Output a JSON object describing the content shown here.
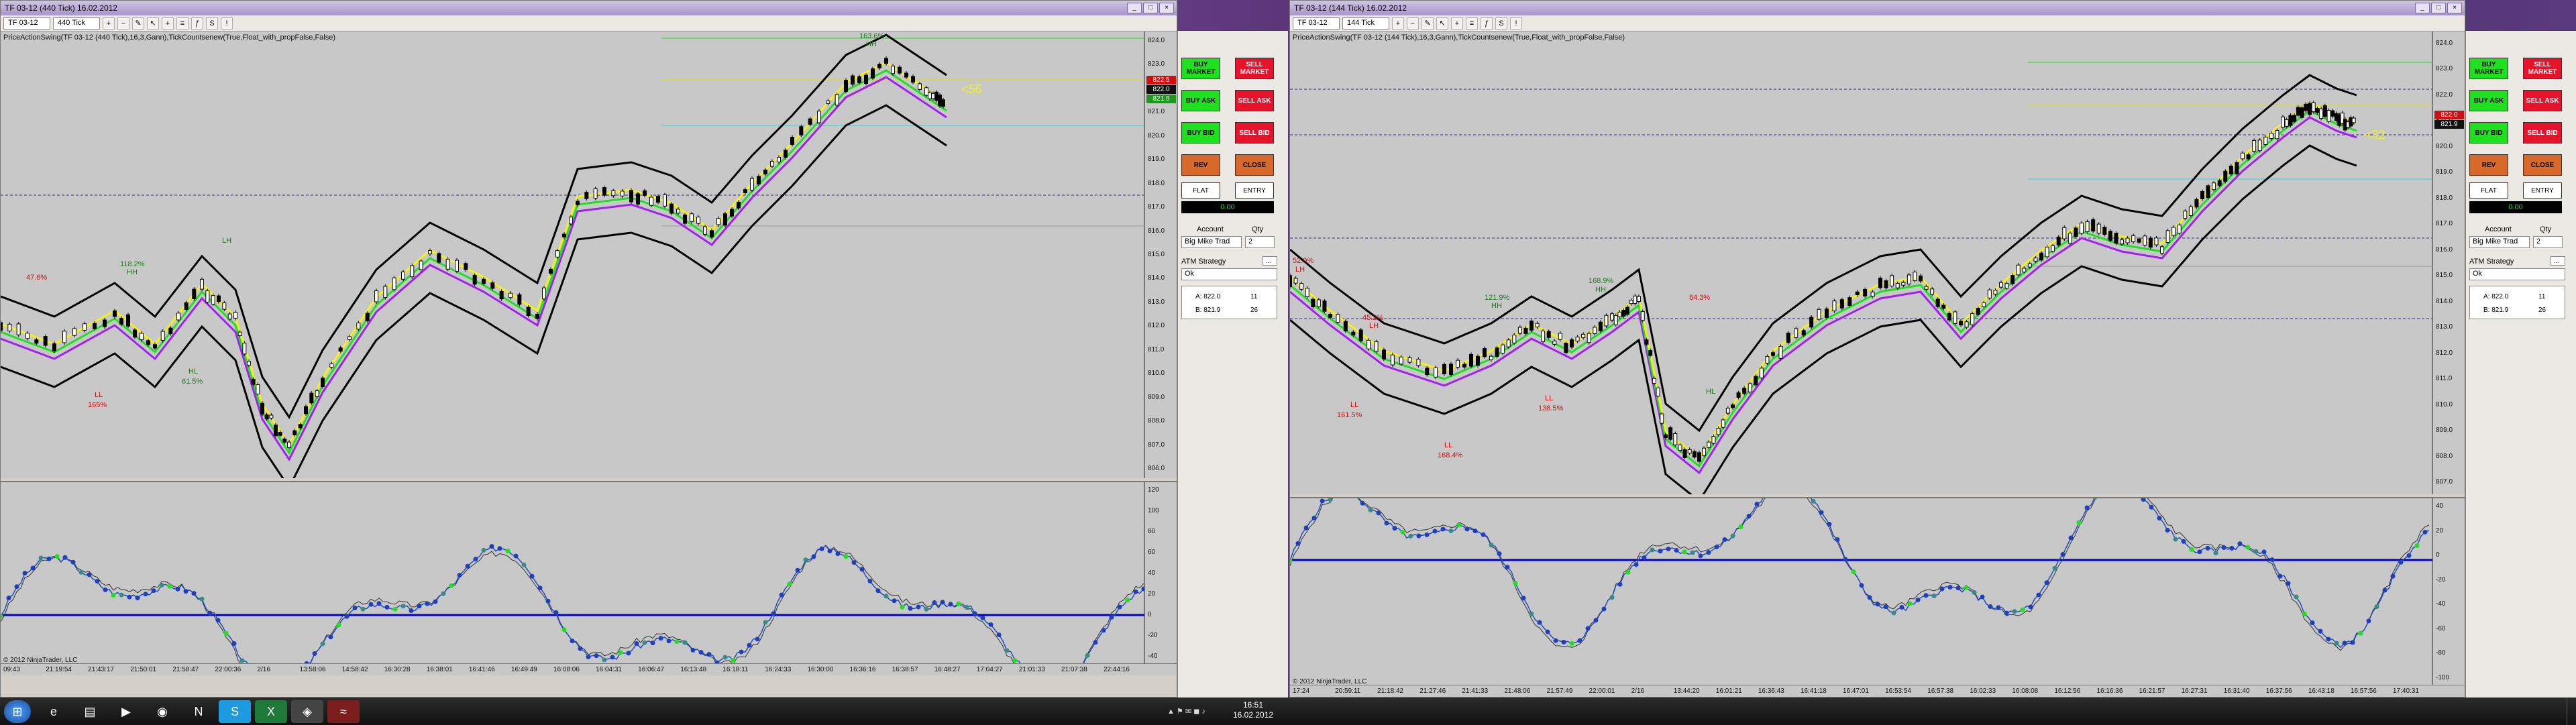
{
  "left": {
    "title": "TF 03-12 (440 Tick)  16.02.2012",
    "instrument": "TF 03-12",
    "period": "440 Tick",
    "indicator_label": "PriceActionSwing(TF 03-12 (440 Tick),16,3,Gann),TickCountsenew(True,Float_with_propFalse,False)",
    "y_ticks": [
      "824.0",
      "823.0",
      "822.0",
      "821.0",
      "820.0",
      "819.0",
      "818.0",
      "817.0",
      "816.0",
      "815.0",
      "814.0",
      "813.0",
      "812.0",
      "811.0",
      "810.0",
      "809.0",
      "808.0",
      "807.0",
      "806.0"
    ],
    "osc_ticks": [
      "120",
      "100",
      "80",
      "60",
      "40",
      "20",
      "0",
      "-20",
      "-40"
    ],
    "x_ticks": [
      "09:43",
      "21:19:54",
      "21:43:17",
      "21:50:01",
      "21:58:47",
      "22:00:36",
      "2/16",
      "13:58:06",
      "14:58:42",
      "16:30:28",
      "16:38:01",
      "16:41:46",
      "16:49:49",
      "16:08:06",
      "16:04:31",
      "16:06:47",
      "16:13:48",
      "16:18:11",
      "16:24:33",
      "16:30:00",
      "16:36:16",
      "16:38:57",
      "16:48:27",
      "17:04:27",
      "21:01:33",
      "21:07:38",
      "22:44:16"
    ],
    "copyright": "© 2012 NinjaTrader, LLC",
    "price_boxes": [
      "822.5",
      "822.0",
      "821.9"
    ],
    "annotations": {
      "hh_top": "163.6%",
      "hh_text": "HH",
      "swing_a": "47.6%",
      "ll1": "LL",
      "ll1_pct": "165%",
      "hl1": "HL",
      "hl1_pct": "61.5%",
      "hh2": "118.2%",
      "hh2_text": "HH",
      "hh3": "LH",
      "big": "<56"
    }
  },
  "right": {
    "title": "TF 03-12 (144 Tick)  16.02.2012",
    "instrument": "TF 03-12",
    "period": "144 Tick",
    "indicator_label": "PriceActionSwing(TF 03-12 (144 Tick),16,3,Gann),TickCountsenew(True,Float_with_propFalse,False)",
    "y_ticks": [
      "824.0",
      "823.0",
      "822.0",
      "821.0",
      "820.0",
      "819.0",
      "818.0",
      "817.0",
      "816.0",
      "815.0",
      "814.0",
      "813.0",
      "812.0",
      "811.0",
      "810.0",
      "809.0",
      "808.0",
      "807.0"
    ],
    "osc_ticks": [
      "40",
      "20",
      "0",
      "-20",
      "-40",
      "-60",
      "-80",
      "-100"
    ],
    "x_ticks": [
      "17:24",
      "20:59:11",
      "21:18:42",
      "21:27:46",
      "21:41:33",
      "21:48:06",
      "21:57:49",
      "22:00:01",
      "2/16",
      "13:44:20",
      "16:01:21",
      "16:36:43",
      "16:41:18",
      "16:47:01",
      "16:53:54",
      "16:57:38",
      "16:02:33",
      "16:08:08",
      "16:12:56",
      "16:16:36",
      "16:21:57",
      "16:27:31",
      "16:31:40",
      "16:37:56",
      "16:43:18",
      "16:57:56",
      "17:40:31"
    ],
    "copyright": "© 2012 NinjaTrader, LLC",
    "price_boxes": [
      "822.0",
      "821.9"
    ],
    "annotations": {
      "ll1": "LL",
      "ll1_pct": "161.5%",
      "ll2": "LL",
      "ll2_pct": "168.4%",
      "lh1": "45.2%",
      "lh1_text": "LH",
      "hh1": "121.9%",
      "hh1_text": "HH",
      "ll3": "LL",
      "ll3_pct": "138.5%",
      "hh2": "168.9%",
      "hh2_text": "HH",
      "lh2": "84.3%",
      "hl": "HL",
      "big": "<32",
      "lh_top": "52.9%",
      "lh_top_text": "LH"
    }
  },
  "order_panel": {
    "buttons": {
      "buy_market": "BUY MARKET",
      "sell_market": "SELL MARKET",
      "buy_ask": "BUY ASK",
      "sell_ask": "SELL ASK",
      "buy_bid": "BUY BID",
      "sell_bid": "SELL BID",
      "rev": "REV",
      "close": "CLOSE",
      "flat": "FLAT",
      "entry": "ENTRY"
    },
    "position": "0.00",
    "account_label": "Account",
    "qty_label": "Qty",
    "account_value": "Big Mike Trad",
    "qty_value": "2",
    "atm_label": "ATM Strategy",
    "atm_value": "Ok",
    "left_ask": "A: 822.0",
    "left_ask_size": "11",
    "left_bid": "B: 821.9",
    "left_bid_size": "26",
    "right_ask": "A: 822.0",
    "right_ask_size": "11",
    "right_bid": "B: 821.9",
    "right_bid_size": "26"
  },
  "taskbar": {
    "time": "16:51",
    "date": "16.02.2012"
  },
  "colors": {
    "bull": "#1fe01f",
    "bear": "#e8132b",
    "yellow": "#f2f21a",
    "purple": "#a020f0",
    "osc_line": "#0000c8"
  }
}
